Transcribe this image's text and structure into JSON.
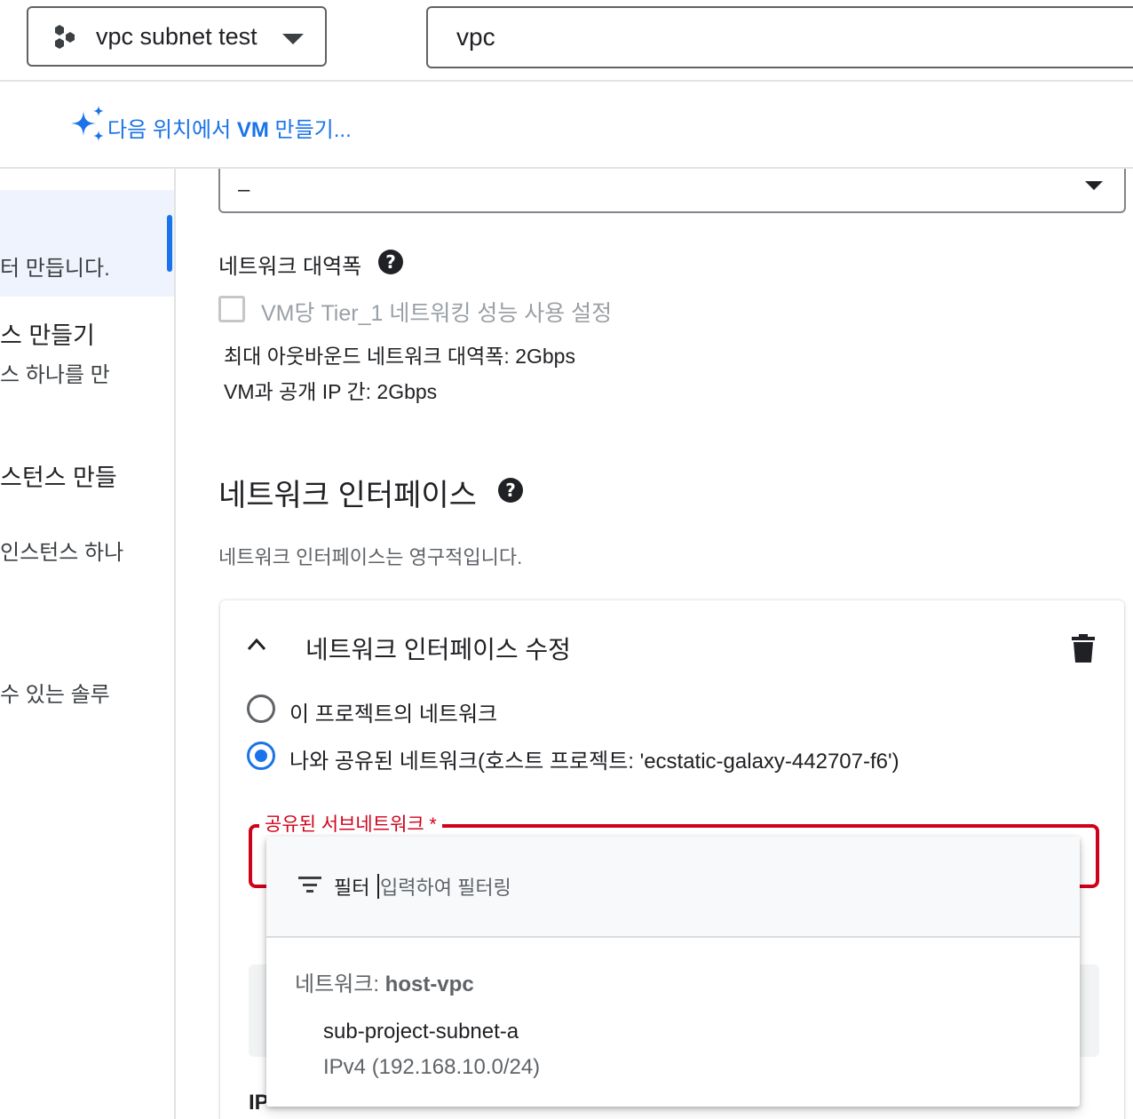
{
  "topbar": {
    "project_name": "vpc subnet test",
    "search_value": "vpc"
  },
  "create_vm": {
    "prefix": "다음 위치에서 ",
    "bold": "VM",
    "suffix": " 만들기..."
  },
  "left_rail": {
    "lines": [
      "터 만듭니다.",
      "스 만들기",
      "스 하나를 만",
      "스턴스 만들",
      "인스턴스 하나",
      "수 있는 솔루"
    ]
  },
  "form": {
    "top_select_value": "–",
    "bandwidth": {
      "heading": "네트워크 대역폭",
      "tier1_label": "VM당 Tier_1 네트워킹 성능 사용 설정",
      "max_outbound": "최대 아웃바운드 네트워크 대역폭: 2Gbps",
      "vm_public_ip": "VM과 공개 IP 간: 2Gbps"
    },
    "network_interfaces": {
      "heading": "네트워크 인터페이스",
      "subtext": "네트워크 인터페이스는 영구적입니다.",
      "card_title": "네트워크 인터페이스 수정",
      "radio_project": "이 프로젝트의 네트워크",
      "radio_shared": "나와 공유된 네트워크(호스트 프로젝트: 'ecstatic-galaxy-442707-f6')",
      "shared_subnet_label": "공유된 서브네트워크 *",
      "ip_label_partial": "IP"
    }
  },
  "dropdown": {
    "filter_label": "필터",
    "filter_placeholder": "입력하여 필터링",
    "group_prefix": "네트워크: ",
    "group_name": "host-vpc",
    "option_name": "sub-project-subnet-a",
    "option_range": "IPv4 (192.168.10.0/24)"
  },
  "colors": {
    "accent": "#1a73e8",
    "error": "#d0021b"
  }
}
